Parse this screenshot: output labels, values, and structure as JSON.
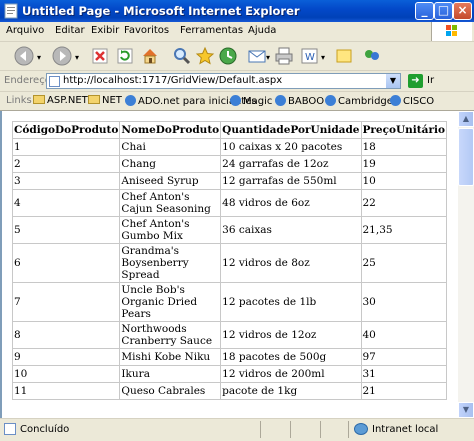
{
  "window": {
    "title": "Untitled Page - Microsoft Internet Explorer"
  },
  "menu": [
    {
      "label": "Arquivo"
    },
    {
      "label": "Editar"
    },
    {
      "label": "Exibir"
    },
    {
      "label": "Favoritos"
    },
    {
      "label": "Ferramentas"
    },
    {
      "label": "Ajuda"
    }
  ],
  "address": {
    "label": "Endereço",
    "url": "http://localhost:1717/GridView/Default.aspx",
    "go_label": "Ir"
  },
  "links": {
    "label": "Links",
    "items": [
      {
        "label": "ASP.NET"
      },
      {
        "label": "NET"
      },
      {
        "label": "ADO.net para iniciantes"
      },
      {
        "label": "Magic"
      },
      {
        "label": "BABOO"
      },
      {
        "label": "Cambridge"
      },
      {
        "label": "CISCO"
      }
    ]
  },
  "grid": {
    "headers": [
      "CódigoDoProduto",
      "NomeDoProduto",
      "QuantidadePorUnidade",
      "PreçoUnitário"
    ],
    "rows": [
      [
        "1",
        "Chai",
        "10 caixas x 20 pacotes",
        "18"
      ],
      [
        "2",
        "Chang",
        "24 garrafas de 12oz",
        "19"
      ],
      [
        "3",
        "Aniseed Syrup",
        "12 garrafas de 550ml",
        "10"
      ],
      [
        "4",
        "Chef Anton's Cajun Seasoning",
        "48 vidros de 6oz",
        "22"
      ],
      [
        "5",
        "Chef Anton's Gumbo Mix",
        "36 caixas",
        "21,35"
      ],
      [
        "6",
        "Grandma's Boysenberry Spread",
        "12 vidros de 8oz",
        "25"
      ],
      [
        "7",
        "Uncle Bob's Organic Dried Pears",
        "12 pacotes de 1lb",
        "30"
      ],
      [
        "8",
        "Northwoods Cranberry Sauce",
        "12 vidros de 12oz",
        "40"
      ],
      [
        "9",
        "Mishi Kobe Niku",
        "18 pacotes de 500g",
        "97"
      ],
      [
        "10",
        "Ikura",
        "12 vidros de 200ml",
        "31"
      ],
      [
        "11",
        "Queso Cabrales",
        "pacote de 1kg",
        "21"
      ]
    ]
  },
  "status": {
    "text": "Concluído",
    "zone": "Intranet local"
  },
  "colors": {
    "titlebar": "#0349c9",
    "chrome": "#ece9d8"
  }
}
